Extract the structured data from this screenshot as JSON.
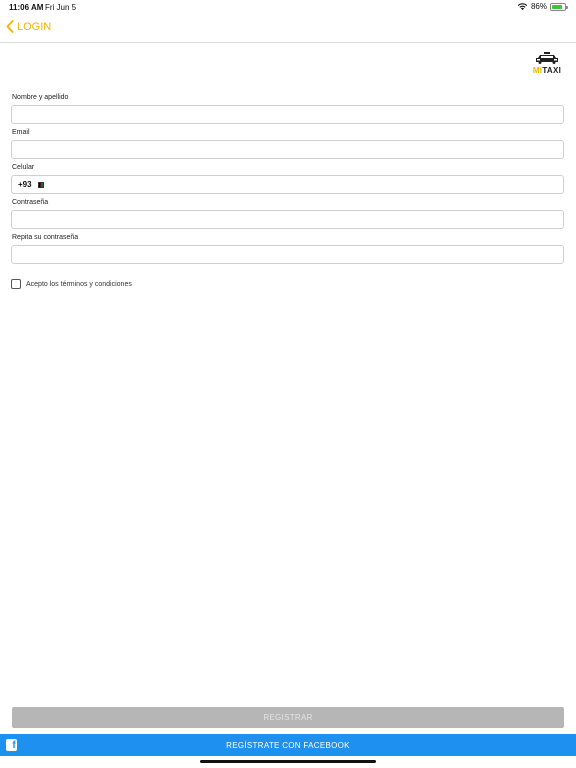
{
  "status_bar": {
    "time": "11:06 AM",
    "date": "Fri Jun 5",
    "battery": "86%",
    "battery_level": 0.86,
    "icons": [
      "wifi-icon",
      "battery-icon"
    ]
  },
  "nav": {
    "back_label": "LOGIN",
    "back_icon": "chevron-left-icon"
  },
  "logo": {
    "icon": "taxi-car-icon",
    "text_prefix": "MI",
    "text_suffix": "TAXI"
  },
  "form": {
    "name_label": "Nombre y apellido",
    "name_value": "",
    "email_label": "Email",
    "email_value": "",
    "phone_label": "Celular",
    "phone_code": "+93",
    "phone_flag_icon": "flag-icon",
    "phone_value": "",
    "password_label": "Contraseña",
    "password_value": "",
    "confirm_label": "Repita su contraseña",
    "confirm_value": "",
    "terms_label": "Acepto los términos y condiciones",
    "terms_checked": false
  },
  "actions": {
    "register_label": "REGISTRAR",
    "facebook_label": "REGÍSTRATE CON FACEBOOK",
    "facebook_icon": "facebook-icon"
  },
  "colors": {
    "accent": "#f4b400",
    "facebook": "#1e90f0",
    "disabled_button": "#b6b6b6"
  }
}
